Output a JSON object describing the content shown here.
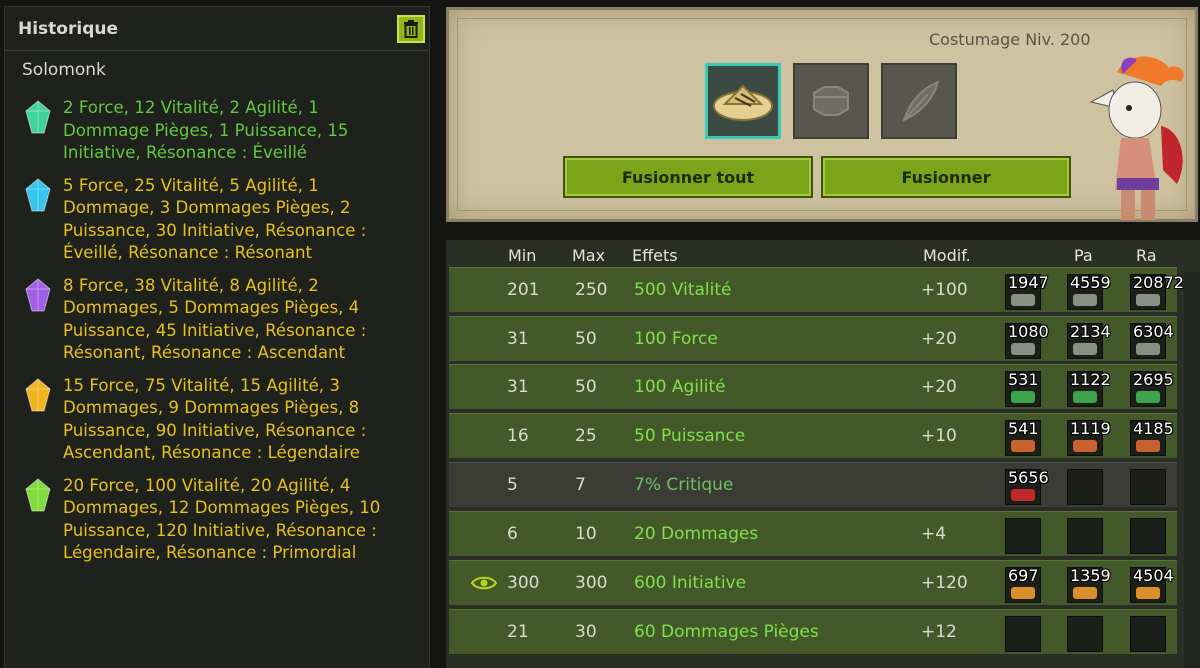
{
  "history": {
    "title": "Historique",
    "subtitle": "Solomonk",
    "entries": [
      {
        "text": "2 Force, 12 Vitalité, 2 Agilité, 1 Dommage Pièges, 1 Puissance, 15 Initiative, Résonance : Éveillé",
        "color": "green",
        "gem": "#3fd39a"
      },
      {
        "text": "5 Force, 25 Vitalité, 5 Agilité, 1 Dommage, 3 Dommages Pièges, 2 Puissance, 30 Initiative, Résonance : Éveillé, Résonance : Résonant",
        "color": "yellow",
        "gem": "#35c6f0"
      },
      {
        "text": "8 Force, 38 Vitalité, 8 Agilité, 2 Dommages, 5 Dommages Pièges, 4 Puissance, 45 Initiative, Résonance : Résonant, Résonance : Ascendant",
        "color": "yellow",
        "gem": "#a25ee8"
      },
      {
        "text": "15 Force, 75 Vitalité, 15 Agilité, 3 Dommages, 9 Dommages Pièges, 8 Puissance, 90 Initiative, Résonance : Ascendant, Résonance : Légendaire",
        "color": "yellow",
        "gem": "#f2b41d"
      },
      {
        "text": "20 Force, 100 Vitalité, 20 Agilité, 4 Dommages, 12 Dommages Pièges, 10 Puissance, 120 Initiative, Résonance : Légendaire, Résonance : Primordial",
        "color": "yellow",
        "gem": "#7edb3a"
      }
    ]
  },
  "fusion": {
    "costume_label": "Costumage Niv. 200",
    "fuse_all_label": "Fusionner tout",
    "fuse_label": "Fusionner"
  },
  "table": {
    "headers": {
      "min": "Min",
      "max": "Max",
      "effects": "Effets",
      "modif": "Modif.",
      "pa": "Pa",
      "ra": "Ra"
    },
    "rows": [
      {
        "min": "201",
        "max": "250",
        "effect": "500 Vitalité",
        "modif": "+100",
        "ba": "1947",
        "pa": "4559",
        "ra": "20872",
        "style": "green",
        "rune": "#8a8f85",
        "eye": false
      },
      {
        "min": "31",
        "max": "50",
        "effect": "100 Force",
        "modif": "+20",
        "ba": "1080",
        "pa": "2134",
        "ra": "6304",
        "style": "green",
        "rune": "#8a8f85",
        "eye": false
      },
      {
        "min": "31",
        "max": "50",
        "effect": "100 Agilité",
        "modif": "+20",
        "ba": "531",
        "pa": "1122",
        "ra": "2695",
        "style": "green",
        "rune": "#3fa34b",
        "eye": false
      },
      {
        "min": "16",
        "max": "25",
        "effect": "50 Puissance",
        "modif": "+10",
        "ba": "541",
        "pa": "1119",
        "ra": "4185",
        "style": "green",
        "rune": "#c8622f",
        "eye": false
      },
      {
        "min": "5",
        "max": "7",
        "effect": "7% Critique",
        "modif": "",
        "ba": "5656",
        "pa": "",
        "ra": "",
        "style": "gray",
        "rune": "#c02a2a",
        "eye": false
      },
      {
        "min": "6",
        "max": "10",
        "effect": "20 Dommages",
        "modif": "+4",
        "ba": "",
        "pa": "",
        "ra": "",
        "style": "green",
        "rune": "#888",
        "eye": false
      },
      {
        "min": "300",
        "max": "300",
        "effect": "600 Initiative",
        "modif": "+120",
        "ba": "697",
        "pa": "1359",
        "ra": "4504",
        "style": "green",
        "rune": "#d9902a",
        "eye": true
      },
      {
        "min": "21",
        "max": "30",
        "effect": "60 Dommages Pièges",
        "modif": "+12",
        "ba": "",
        "pa": "",
        "ra": "",
        "style": "green",
        "rune": "#888",
        "eye": false
      }
    ]
  }
}
